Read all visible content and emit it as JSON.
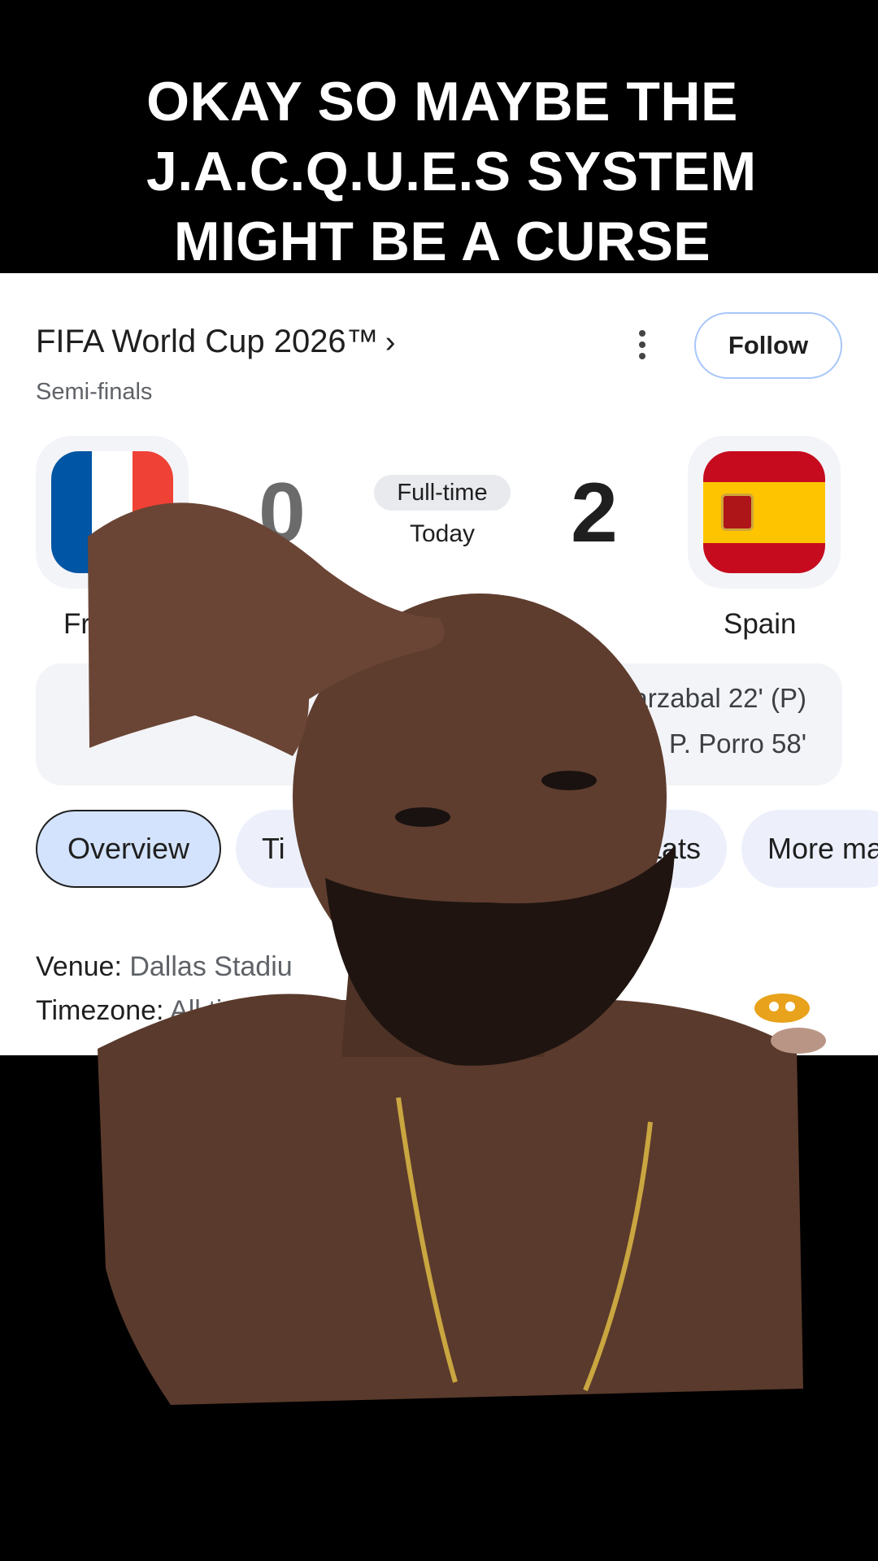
{
  "caption": {
    "lines": [
      "OKAY SO MAYBE THE",
      "J.A.C.Q.U.E.S SYSTEM",
      "MIGHT BE A CURSE"
    ]
  },
  "match": {
    "tournament": "FIFA World Cup 2026™",
    "tournament_chevron": "›",
    "stage": "Semi-finals",
    "follow_label": "Follow",
    "status": "Full-time",
    "date": "Today",
    "home": {
      "name_visible": "Fr",
      "score": "0",
      "flag": "france-flag"
    },
    "away": {
      "name": "Spain",
      "score": "2",
      "flag": "spain-flag"
    },
    "scorers": [
      "varzabal 22' (P)",
      "P. Porro 58'"
    ],
    "tabs": [
      {
        "label": "Overview",
        "active": true
      },
      {
        "label": "Ti",
        "active": false
      },
      {
        "label": "tats",
        "active": false
      },
      {
        "label": "More ma",
        "active": false
      }
    ],
    "venue_label": "Venue:",
    "venue_value": "Dallas Stadiu",
    "timezone_label": "Timezone:",
    "timezone_value": "All times ar"
  },
  "colors": {
    "follow_border": "#a8c7fa",
    "tab_active_bg": "#d3e3fd",
    "france_blue": "#0055a4",
    "france_red": "#ef4135",
    "spain_red": "#c60b1e",
    "spain_yellow": "#ffc400"
  },
  "icons": [
    "more-vert-icon",
    "chevron-right-icon",
    "sticker-icon"
  ]
}
